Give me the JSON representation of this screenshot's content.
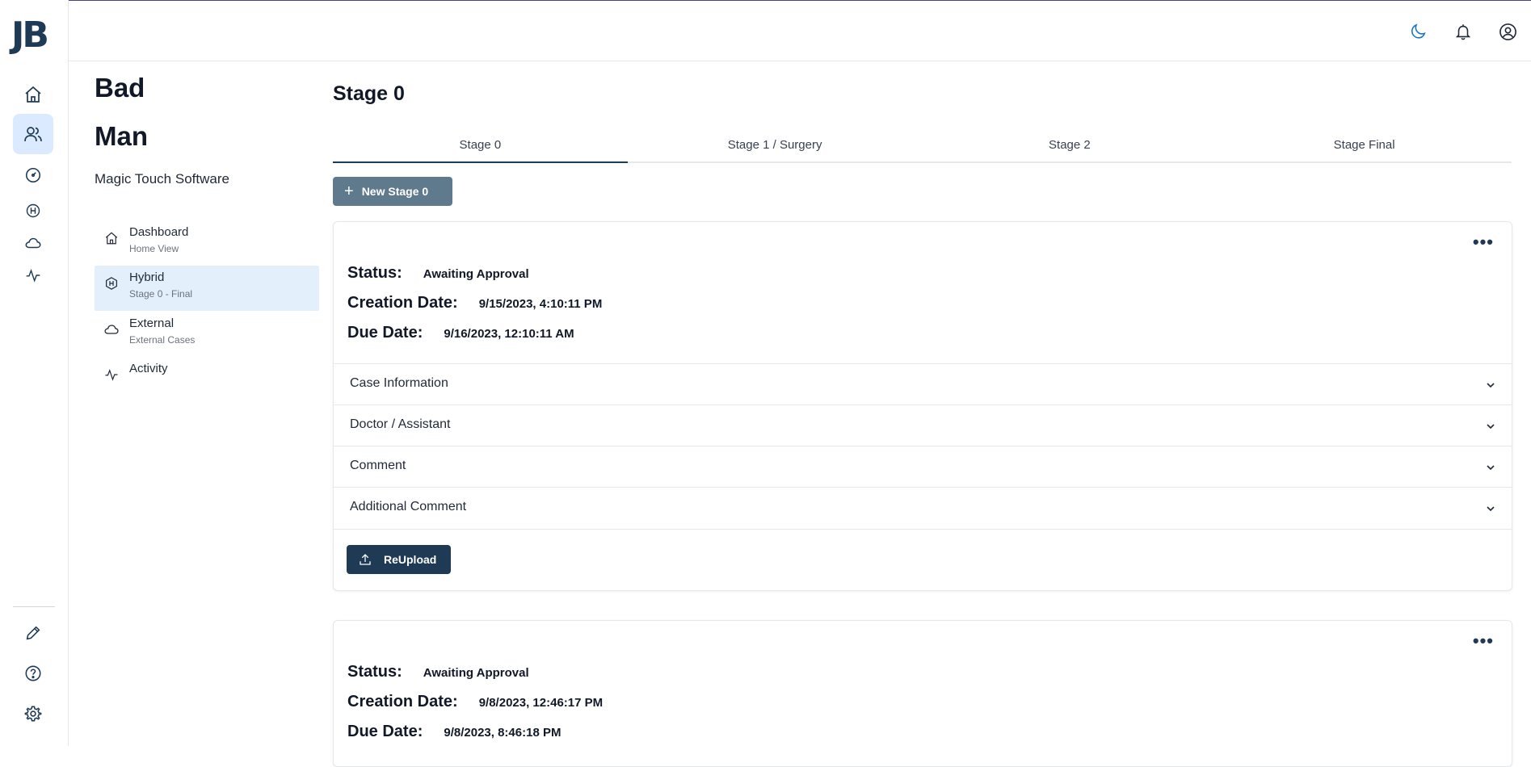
{
  "app": {
    "logo_text": "JB"
  },
  "header": {
    "icons": [
      "moon-icon",
      "bell-icon",
      "user-circle-icon"
    ]
  },
  "profile": {
    "first_name": "Bad",
    "last_name": "Man",
    "company": "Magic Touch Software"
  },
  "sidebar": {
    "items": [
      {
        "label": "Dashboard",
        "sub": "Home View",
        "icon": "home-icon"
      },
      {
        "label": "Hybrid",
        "sub": "Stage 0 - Final",
        "icon": "hybrid-h-icon",
        "active": true
      },
      {
        "label": "External",
        "sub": "External Cases",
        "icon": "cloud-icon"
      },
      {
        "label": "Activity",
        "sub": "",
        "icon": "activity-icon"
      }
    ]
  },
  "main": {
    "title": "Stage 0",
    "tabs": [
      {
        "label": "Stage 0",
        "active": true
      },
      {
        "label": "Stage 1 / Surgery"
      },
      {
        "label": "Stage 2"
      },
      {
        "label": "Stage Final"
      }
    ],
    "new_button": "New Stage 0",
    "cards": [
      {
        "status_label": "Status:",
        "status": "Awaiting Approval",
        "creation_label": "Creation Date:",
        "creation": "9/15/2023, 4:10:11 PM",
        "due_label": "Due Date:",
        "due": "9/16/2023, 12:10:11 AM",
        "sections": [
          "Case Information",
          "Doctor / Assistant",
          "Comment",
          "Additional Comment"
        ],
        "reupload_label": "ReUpload"
      },
      {
        "status_label": "Status:",
        "status": "Awaiting Approval",
        "creation_label": "Creation Date:",
        "creation": "9/8/2023, 12:46:17 PM",
        "due_label": "Due Date:",
        "due": "9/8/2023, 8:46:18 PM"
      }
    ]
  },
  "colors": {
    "primary": "#1e3a55",
    "secondary_button": "#607a8d",
    "active_nav_bg": "#e3effb",
    "moon_accent": "#1a73c8"
  }
}
